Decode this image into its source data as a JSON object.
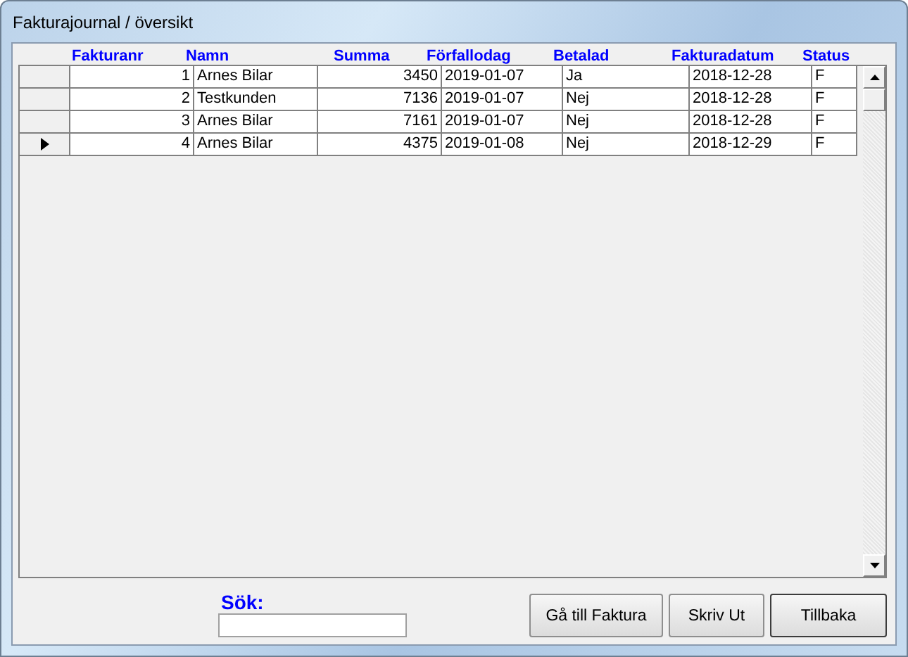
{
  "window": {
    "title": "Fakturajournal / översikt"
  },
  "table": {
    "columns": [
      "Fakturanr",
      "Namn",
      "Summa",
      "Förfallodag",
      "Betalad",
      "Fakturadatum",
      "Status"
    ],
    "rows": [
      {
        "selected": false,
        "cells": [
          "1",
          "Arnes Bilar",
          "3450",
          "2019-01-07",
          "Ja",
          "2018-12-28",
          "F"
        ]
      },
      {
        "selected": false,
        "cells": [
          "2",
          "Testkunden",
          "7136",
          "2019-01-07",
          "Nej",
          "2018-12-28",
          "F"
        ]
      },
      {
        "selected": false,
        "cells": [
          "3",
          "Arnes Bilar",
          "7161",
          "2019-01-07",
          "Nej",
          "2018-12-28",
          "F"
        ]
      },
      {
        "selected": true,
        "cells": [
          "4",
          "Arnes Bilar",
          "4375",
          "2019-01-08",
          "Nej",
          "2018-12-29",
          "F"
        ]
      }
    ]
  },
  "search": {
    "label": "Sök:"
  },
  "buttons": [
    "Gå till Faktura",
    "Skriv Ut",
    "Tillbaka"
  ]
}
